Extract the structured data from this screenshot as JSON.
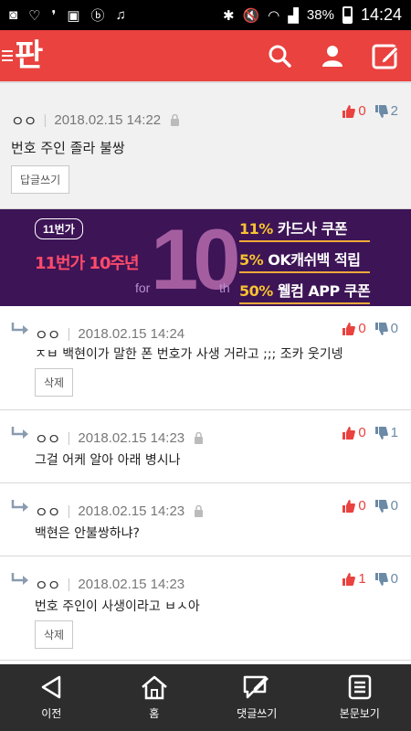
{
  "status_bar": {
    "battery": "38%",
    "time": "14:24"
  },
  "header": {
    "logo": "판"
  },
  "main_comment": {
    "author": "ㅇㅇ",
    "date": "2018.02.15 14:22",
    "up": "0",
    "down": "2",
    "text": "번호 주인 졸라 불쌍",
    "button": "답글쓰기"
  },
  "banner": {
    "badge": "11번가",
    "slogan": "11번가 10주년",
    "big_number": "10",
    "for_text": "for",
    "th_text": "th",
    "lines": [
      {
        "pct": "11%",
        "text": " 카드사 쿠폰"
      },
      {
        "pct": "5%",
        "text": " OK캐쉬백 적립"
      },
      {
        "pct": "50%",
        "text": " 웰컴 APP 쿠폰"
      }
    ]
  },
  "replies": [
    {
      "author": "ㅇㅇ",
      "date": "2018.02.15 14:24",
      "up": "0",
      "down": "0",
      "text": "ㅈㅂ 백현이가 말한 폰 번호가 사생 거라고 ;;; 조카 웃기넹",
      "button": "삭제",
      "locked": false
    },
    {
      "author": "ㅇㅇ",
      "date": "2018.02.15 14:23",
      "up": "0",
      "down": "1",
      "text": "그걸 어케 알아 아래 병시나",
      "button": "",
      "locked": true
    },
    {
      "author": "ㅇㅇ",
      "date": "2018.02.15 14:23",
      "up": "0",
      "down": "0",
      "text": "백현은 안불쌍하냐?",
      "button": "",
      "locked": true
    },
    {
      "author": "ㅇㅇ",
      "date": "2018.02.15 14:23",
      "up": "1",
      "down": "0",
      "text": "번호 주인이 사생이라고 ㅂㅅ아",
      "button": "삭제",
      "locked": false
    }
  ],
  "bottom_nav": {
    "prev": "이전",
    "home": "홈",
    "write_comment": "댓글쓰기",
    "view_post": "본문보기"
  }
}
